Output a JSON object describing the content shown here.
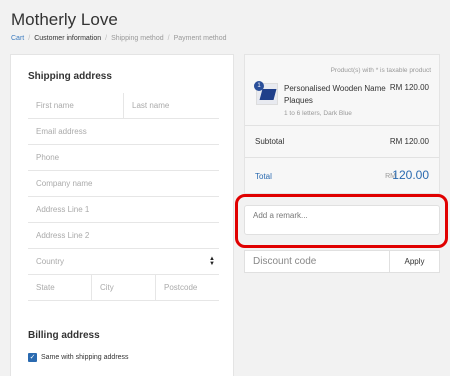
{
  "store": {
    "title": "Motherly Love"
  },
  "breadcrumb": {
    "items": [
      "Cart",
      "Customer information",
      "Shipping method",
      "Payment method"
    ],
    "separator": "/"
  },
  "shipping": {
    "title": "Shipping address",
    "first_name": "First name",
    "last_name": "Last name",
    "email": "Email address",
    "phone": "Phone",
    "company": "Company name",
    "address1": "Address Line 1",
    "address2": "Address Line 2",
    "country": "Country",
    "state": "State",
    "city": "City",
    "postcode": "Postcode"
  },
  "billing": {
    "title": "Billing address",
    "same_label": "Same with shipping address",
    "same_checked": true
  },
  "summary": {
    "tax_note": "Product(s) with * is taxable product",
    "product": {
      "qty_badge": "1",
      "name": "Personalised Wooden Name Plaques",
      "variant": "1 to 6 letters, Dark Blue",
      "price": "RM 120.00"
    },
    "subtotal_label": "Subtotal",
    "subtotal_value": "RM 120.00",
    "total_label": "Total",
    "total_currency": "RM",
    "total_amount": "120.00"
  },
  "remark": {
    "placeholder": "Add a remark..."
  },
  "discount": {
    "placeholder": "Discount code",
    "apply_label": "Apply"
  },
  "colors": {
    "accent": "#2a6ab0",
    "highlight": "#e00000"
  },
  "icons": {
    "select": "select-arrows-icon",
    "check": "checkmark-icon"
  }
}
